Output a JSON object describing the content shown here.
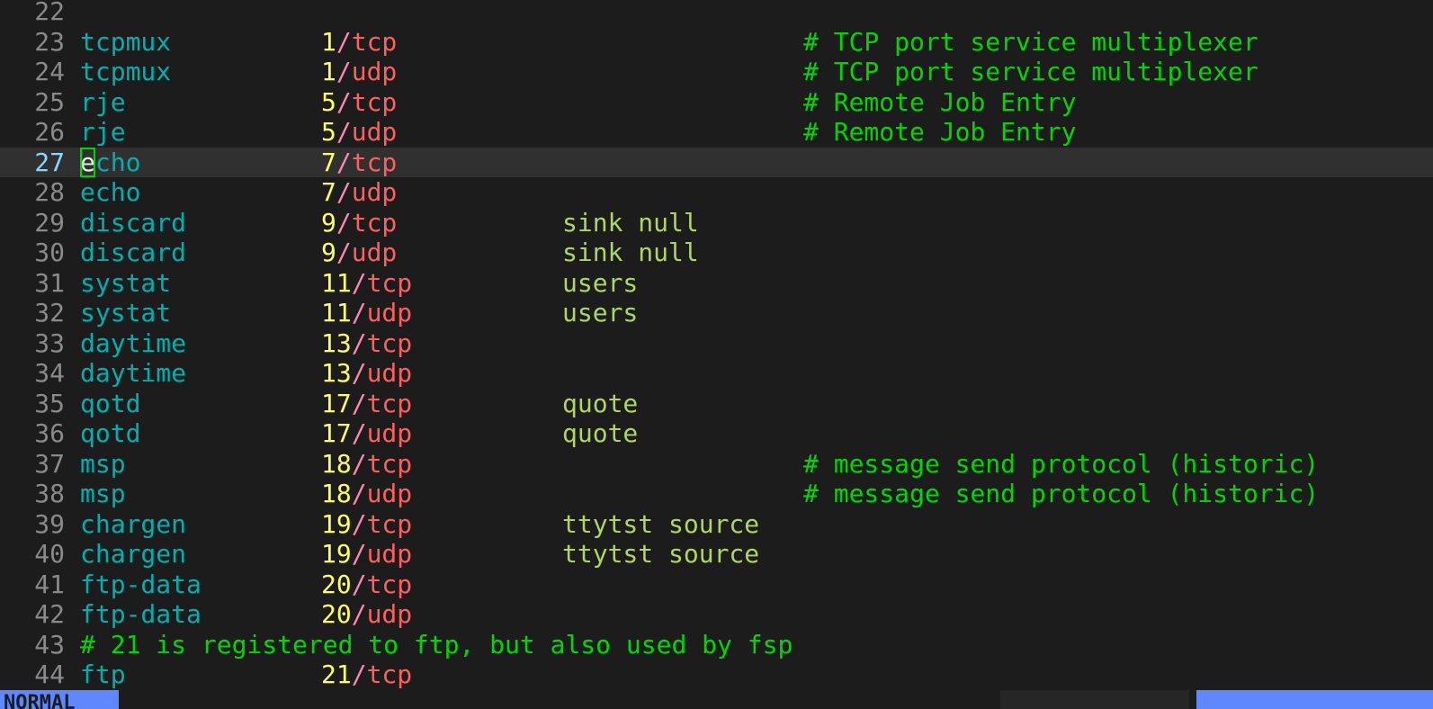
{
  "editor": {
    "current_line": 27,
    "lines": [
      {
        "n": "22",
        "service": "",
        "port": "",
        "proto": "",
        "aliases": "",
        "comment": ""
      },
      {
        "n": "23",
        "service": "tcpmux",
        "port": "1",
        "proto": "tcp",
        "aliases": "",
        "comment": "# TCP port service multiplexer"
      },
      {
        "n": "24",
        "service": "tcpmux",
        "port": "1",
        "proto": "udp",
        "aliases": "",
        "comment": "# TCP port service multiplexer"
      },
      {
        "n": "25",
        "service": "rje",
        "port": "5",
        "proto": "tcp",
        "aliases": "",
        "comment": "# Remote Job Entry"
      },
      {
        "n": "26",
        "service": "rje",
        "port": "5",
        "proto": "udp",
        "aliases": "",
        "comment": "# Remote Job Entry"
      },
      {
        "n": "27",
        "service": "echo",
        "port": "7",
        "proto": "tcp",
        "aliases": "",
        "comment": ""
      },
      {
        "n": "28",
        "service": "echo",
        "port": "7",
        "proto": "udp",
        "aliases": "",
        "comment": ""
      },
      {
        "n": "29",
        "service": "discard",
        "port": "9",
        "proto": "tcp",
        "aliases": "sink null",
        "comment": ""
      },
      {
        "n": "30",
        "service": "discard",
        "port": "9",
        "proto": "udp",
        "aliases": "sink null",
        "comment": ""
      },
      {
        "n": "31",
        "service": "systat",
        "port": "11",
        "proto": "tcp",
        "aliases": "users",
        "comment": ""
      },
      {
        "n": "32",
        "service": "systat",
        "port": "11",
        "proto": "udp",
        "aliases": "users",
        "comment": ""
      },
      {
        "n": "33",
        "service": "daytime",
        "port": "13",
        "proto": "tcp",
        "aliases": "",
        "comment": ""
      },
      {
        "n": "34",
        "service": "daytime",
        "port": "13",
        "proto": "udp",
        "aliases": "",
        "comment": ""
      },
      {
        "n": "35",
        "service": "qotd",
        "port": "17",
        "proto": "tcp",
        "aliases": "quote",
        "comment": ""
      },
      {
        "n": "36",
        "service": "qotd",
        "port": "17",
        "proto": "udp",
        "aliases": "quote",
        "comment": ""
      },
      {
        "n": "37",
        "service": "msp",
        "port": "18",
        "proto": "tcp",
        "aliases": "",
        "comment": "# message send protocol (historic)"
      },
      {
        "n": "38",
        "service": "msp",
        "port": "18",
        "proto": "udp",
        "aliases": "",
        "comment": "# message send protocol (historic)"
      },
      {
        "n": "39",
        "service": "chargen",
        "port": "19",
        "proto": "tcp",
        "aliases": "ttytst source",
        "comment": ""
      },
      {
        "n": "40",
        "service": "chargen",
        "port": "19",
        "proto": "udp",
        "aliases": "ttytst source",
        "comment": ""
      },
      {
        "n": "41",
        "service": "ftp-data",
        "port": "20",
        "proto": "tcp",
        "aliases": "",
        "comment": ""
      },
      {
        "n": "42",
        "service": "ftp-data",
        "port": "20",
        "proto": "udp",
        "aliases": "",
        "comment": ""
      },
      {
        "n": "43",
        "service": "",
        "port": "",
        "proto": "",
        "aliases": "",
        "comment": "",
        "full_comment": "# 21 is registered to ftp, but also used by fsp"
      },
      {
        "n": "44",
        "service": "ftp",
        "port": "21",
        "proto": "tcp",
        "aliases": "",
        "comment": ""
      }
    ]
  },
  "statusline": {
    "mode": "NORMAL"
  },
  "colors": {
    "background": "#1c1c1c",
    "service": "#00afaf",
    "port": "#ffff5f",
    "protocol": "#ff5f5f",
    "alias": "#afd75f",
    "comment": "#00d700",
    "mode_bg": "#5f87ff"
  }
}
